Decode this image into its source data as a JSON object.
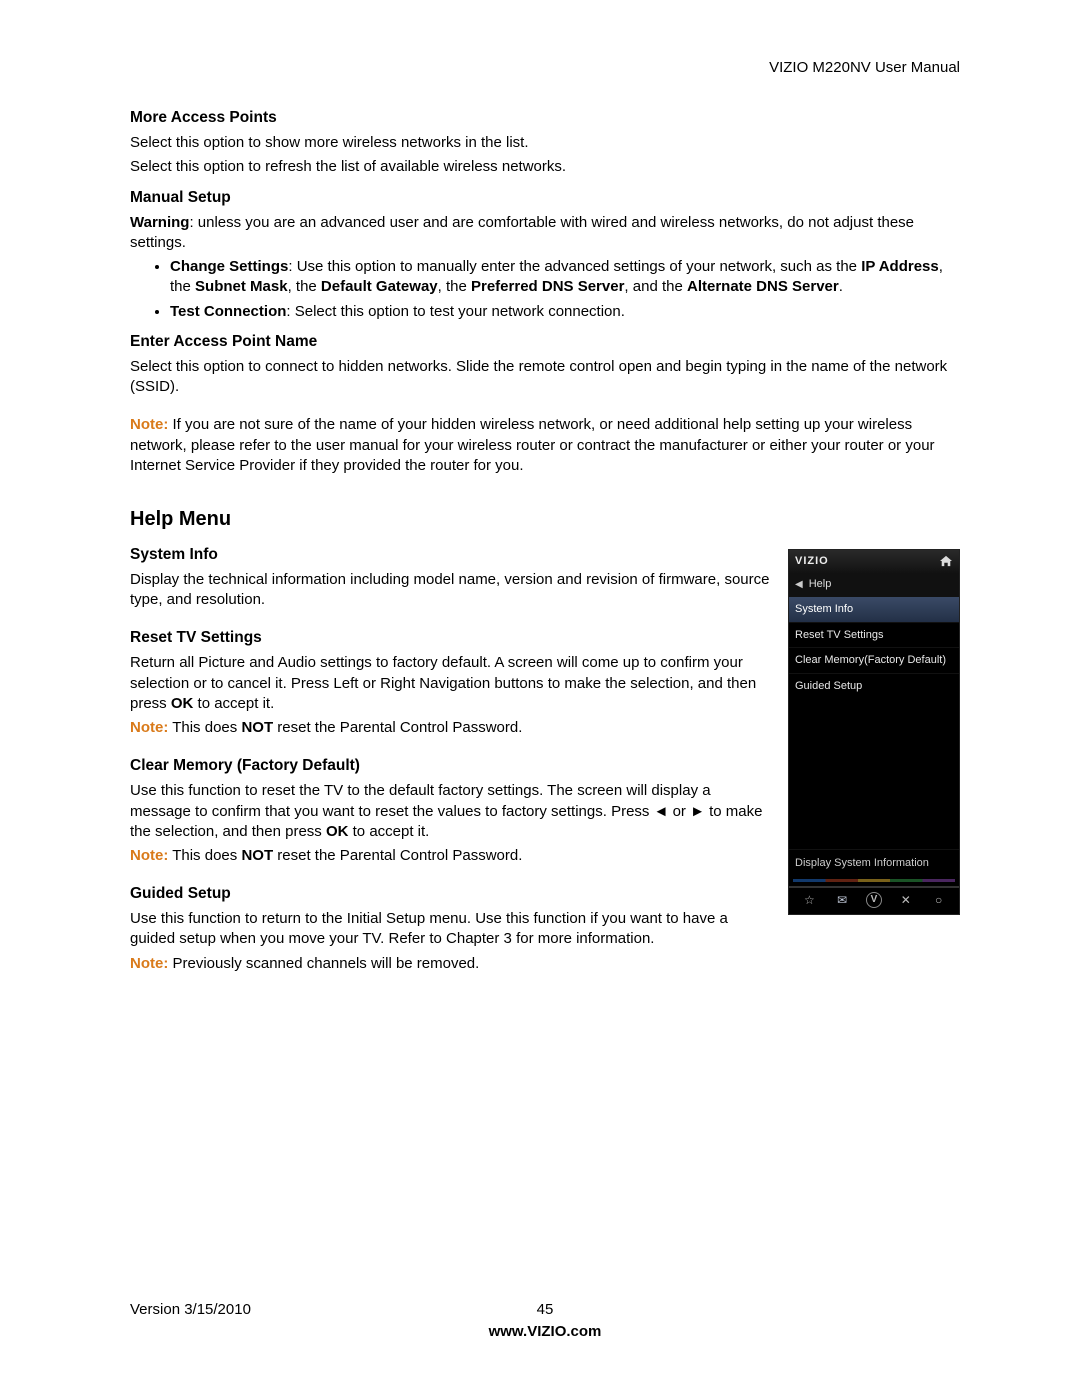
{
  "header": {
    "doc_title": "VIZIO M220NV User Manual"
  },
  "sections": {
    "more_access_points": {
      "heading": "More Access Points",
      "line1": "Select this option to show more wireless networks in the list.",
      "line2": "Select this option to refresh the list of available wireless networks."
    },
    "manual_setup": {
      "heading": "Manual Setup",
      "warning_label": "Warning",
      "warning_text": ": unless you are an advanced user and are comfortable with wired and wireless networks, do not adjust these settings.",
      "bullet1_bold": "Change Settings",
      "bullet1_text_a": ": Use this option to manually enter the advanced settings of your network, such as the ",
      "bullet1_b1": "IP Address",
      "bullet1_sep1": ", the ",
      "bullet1_b2": "Subnet Mask",
      "bullet1_sep2": ", the ",
      "bullet1_b3": "Default Gateway",
      "bullet1_sep3": ", the ",
      "bullet1_b4": "Preferred DNS Server",
      "bullet1_sep4": ", and the ",
      "bullet1_b5": "Alternate DNS Server",
      "bullet1_end": ".",
      "bullet2_bold": "Test Connection",
      "bullet2_text": ": Select this option to test your network connection."
    },
    "enter_ap": {
      "heading": "Enter Access Point Name",
      "text": "Select this option to connect to hidden networks. Slide the remote control open and begin typing in the name of the network (SSID)."
    },
    "hidden_note": {
      "note_label": "Note:",
      "text": " If you are not sure of the name of your hidden wireless network, or need additional help setting up your wireless network, please refer to the user manual for your wireless router or contract the manufacturer or either your router or your Internet Service Provider if they provided the router for you."
    },
    "help_menu": {
      "heading": "Help Menu"
    },
    "system_info": {
      "heading": "System Info",
      "text": "Display the technical information including model name, version and revision of firmware, source type, and resolution."
    },
    "reset_tv": {
      "heading": "Reset TV Settings",
      "text_a": "Return all Picture and Audio settings to factory default. A screen will come up to confirm your selection or to cancel it. Press Left or Right Navigation buttons to make the selection, and then press ",
      "ok": "OK",
      "text_b": " to accept it.",
      "note_label": "Note:",
      "note_a": " This does ",
      "note_not": "NOT",
      "note_b": " reset the Parental Control Password."
    },
    "clear_mem": {
      "heading": "Clear Memory (Factory Default)",
      "text_a": "Use this function to reset the TV to the default factory settings. The screen will display a message to confirm that you want to reset the values to factory settings. Press ◄ or ► to make the selection, and then press ",
      "ok": "OK",
      "text_b": " to accept it.",
      "note_label": "Note:",
      "note_a": " This does ",
      "note_not": "NOT",
      "note_b": " reset the Parental Control Password."
    },
    "guided": {
      "heading": "Guided Setup",
      "text": "Use this function to return to the Initial Setup menu. Use this function if you want to have a guided setup when you move your TV. Refer to Chapter 3 for more information.",
      "note_label": "Note:",
      "note_text": " Previously scanned channels will be removed."
    }
  },
  "osd": {
    "brand": "VIZIO",
    "breadcrumb": "Help",
    "items": [
      "System Info",
      "Reset TV Settings",
      "Clear Memory(Factory Default)",
      "Guided Setup"
    ],
    "hint": "Display System Information",
    "v_label": "V"
  },
  "footer": {
    "version": "Version 3/15/2010",
    "page": "45",
    "url": "www.VIZIO.com"
  }
}
